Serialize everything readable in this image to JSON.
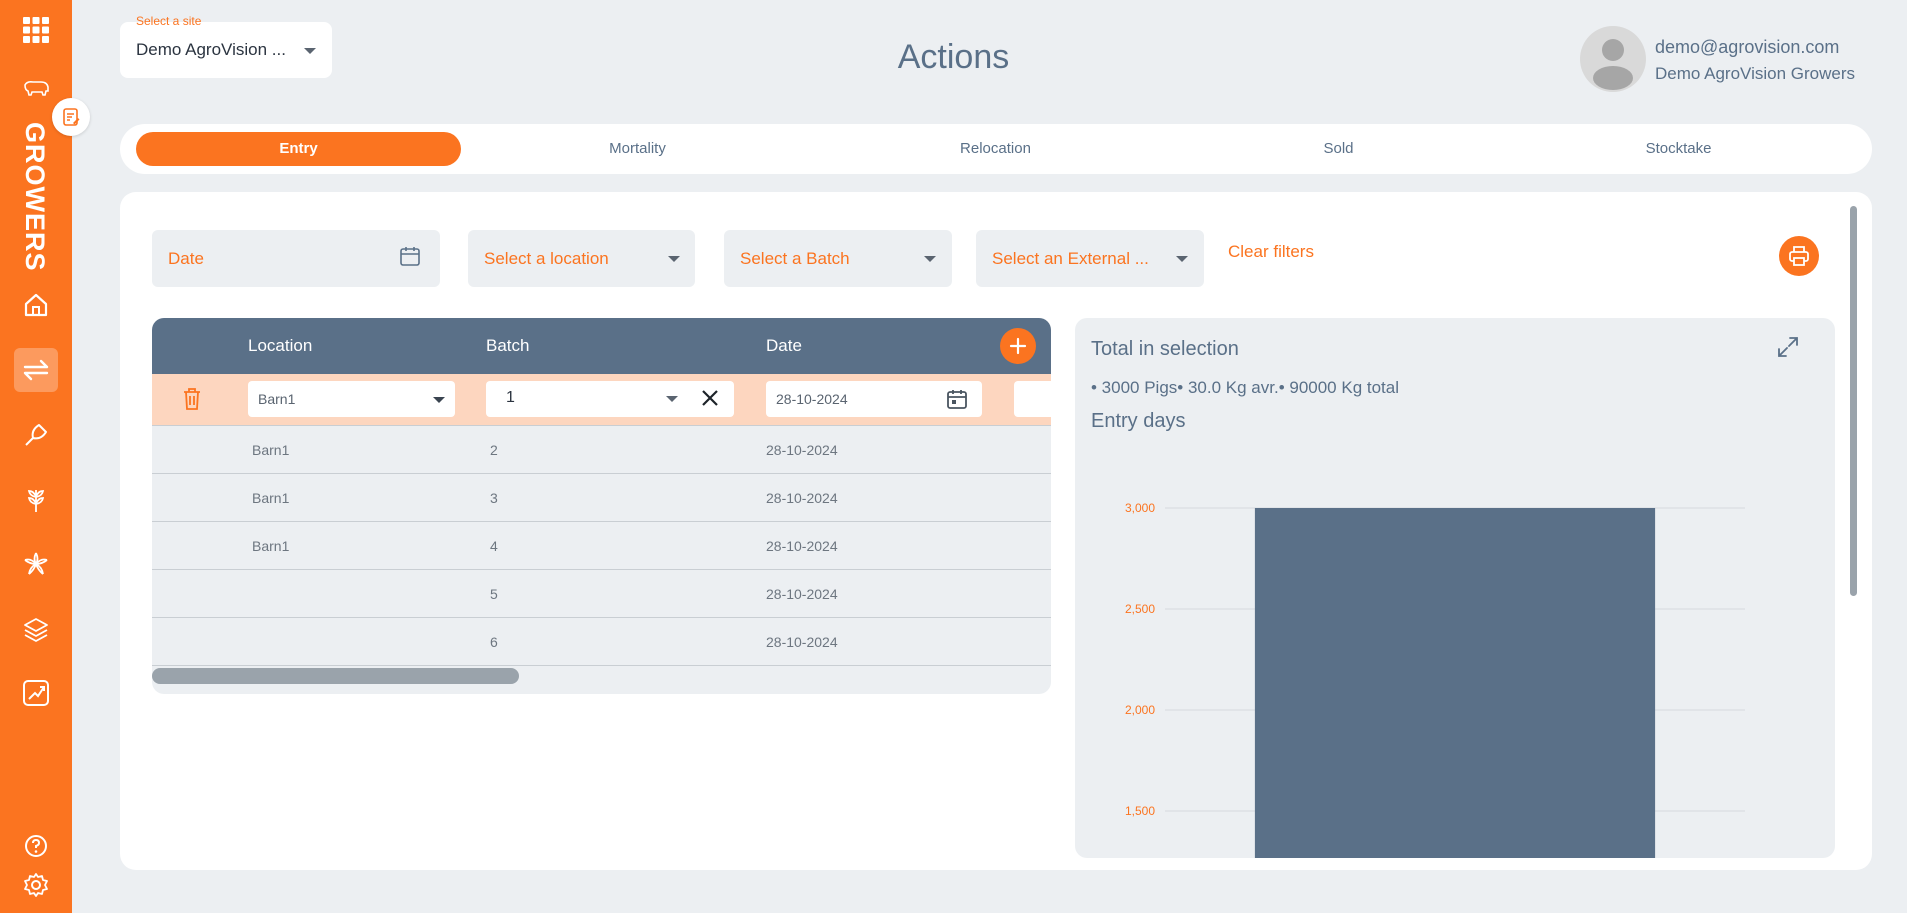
{
  "site": {
    "label": "Select a site",
    "value": "Demo AgroVision ..."
  },
  "page_title": "Actions",
  "user": {
    "email": "demo@agrovision.com",
    "company": "Demo AgroVision Growers"
  },
  "sidebar": {
    "brand": "GROWERS",
    "items": [
      {
        "icon": "apps-grid-icon"
      },
      {
        "icon": "pig-icon"
      },
      {
        "icon": "home-icon"
      },
      {
        "icon": "transfer-arrows-icon",
        "active": true
      },
      {
        "icon": "feed-scoop-icon"
      },
      {
        "icon": "grain-icon"
      },
      {
        "icon": "health-icon"
      },
      {
        "icon": "layers-icon"
      },
      {
        "icon": "chart-growth-icon"
      },
      {
        "icon": "help-icon"
      },
      {
        "icon": "settings-icon"
      }
    ]
  },
  "tabs": [
    {
      "label": "Entry",
      "active": true
    },
    {
      "label": "Mortality"
    },
    {
      "label": "Relocation"
    },
    {
      "label": "Sold"
    },
    {
      "label": "Stocktake"
    }
  ],
  "filters": {
    "date": "Date",
    "location": "Select a location",
    "batch": "Select a Batch",
    "external": "Select an External ...",
    "clear": "Clear filters"
  },
  "table": {
    "headers": {
      "location": "Location",
      "batch": "Batch",
      "date": "Date"
    },
    "edit_row": {
      "location": "Barn1",
      "batch": "1",
      "date": "28-10-2024"
    },
    "rows": [
      {
        "location": "Barn1",
        "batch": "2",
        "date": "28-10-2024"
      },
      {
        "location": "Barn1",
        "batch": "3",
        "date": "28-10-2024"
      },
      {
        "location": "Barn1",
        "batch": "4",
        "date": "28-10-2024"
      },
      {
        "location": "",
        "batch": "5",
        "date": "28-10-2024"
      },
      {
        "location": "",
        "batch": "6",
        "date": "28-10-2024"
      }
    ]
  },
  "summary": {
    "title": "Total in selection",
    "text": "• 3000 Pigs• 30.0 Kg avr.• 90000 Kg total",
    "chart_title": "Entry days"
  },
  "colors": {
    "accent": "#fb7420",
    "slate": "#5a7088",
    "background": "#eceff2"
  },
  "chart_data": {
    "type": "bar",
    "title": "Entry days",
    "categories": [
      ""
    ],
    "values": [
      3000
    ],
    "yticks": [
      "3,000",
      "2,500",
      "2,000",
      "1,500"
    ],
    "ytick_values": [
      3000,
      2500,
      2000,
      1500
    ],
    "ylim": [
      1300,
      3000
    ],
    "bar_color": "#5a7088",
    "grid": true
  }
}
